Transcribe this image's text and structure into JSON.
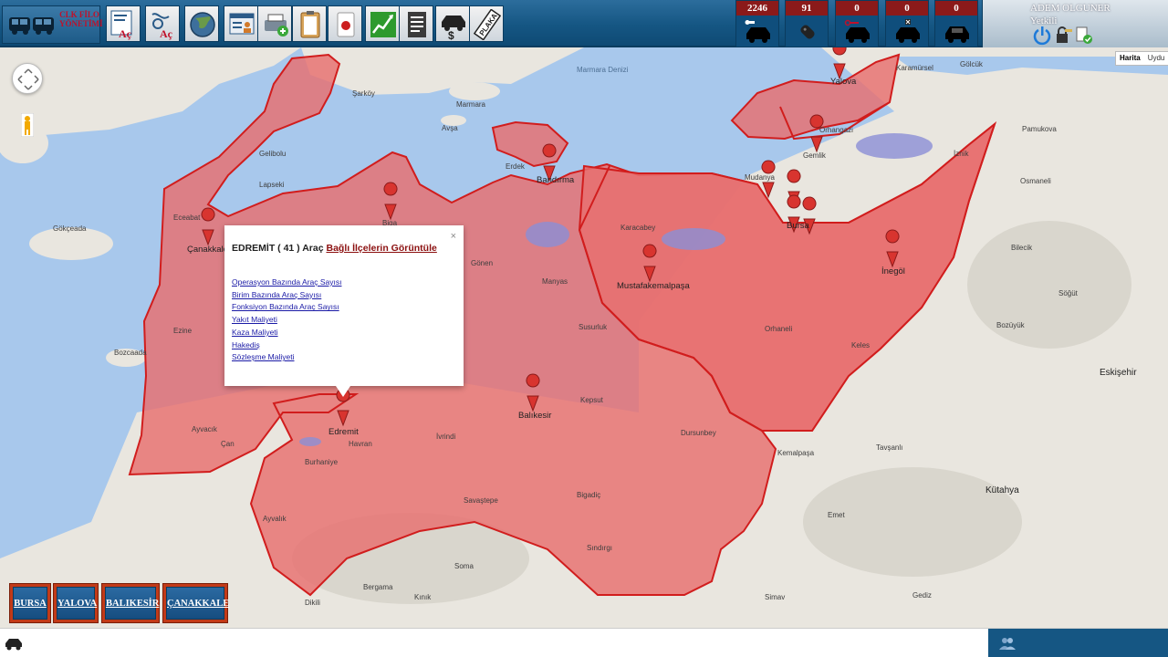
{
  "app": {
    "logo_text": "CLK FİLO YÖNETİMİ"
  },
  "toolbar": {
    "tools": [
      {
        "name": "open-report-tool",
        "label": "Aç"
      },
      {
        "name": "open-route-tool",
        "label": "Aç"
      },
      {
        "name": "globe-tool",
        "label": ""
      },
      {
        "name": "user-card-tool",
        "label": ""
      },
      {
        "name": "add-vehicle-tool",
        "label": ""
      },
      {
        "name": "clipboard-tool",
        "label": ""
      },
      {
        "name": "alert-tool",
        "label": ""
      },
      {
        "name": "chart-tool",
        "label": ""
      },
      {
        "name": "document-tool",
        "label": ""
      },
      {
        "name": "cost-tool",
        "label": ""
      },
      {
        "name": "plate-tool",
        "label": "PLAKA"
      }
    ]
  },
  "stats": [
    {
      "value": "2246",
      "icon": "car-key-icon"
    },
    {
      "value": "91",
      "icon": "key-icon"
    },
    {
      "value": "0",
      "icon": "car-key-icon"
    },
    {
      "value": "0",
      "icon": "car-wrench-icon"
    },
    {
      "value": "0",
      "icon": "car-icon"
    }
  ],
  "user": {
    "name": "ADEM OLGUNER",
    "role": "Yetkili"
  },
  "map": {
    "maptype": {
      "map": "Harita",
      "satellite": "Uydu"
    },
    "popup": {
      "title": "EDREMİT ( 41 ) Araç",
      "link": "Bağlı İlçelerin Görüntüle",
      "close": "×",
      "items": [
        "Operasyon Bazında Araç Sayısı",
        "Birim Bazında Araç Sayısı",
        "Fonksiyon Bazında Araç Sayısı",
        "Yakıt Maliyeti",
        "Kaza Maliyeti",
        "Hakediş",
        "Sözleşme Maliyeti"
      ]
    },
    "labels": {
      "marmara_sea": "Marmara Denizi",
      "bursa": "Bursa",
      "balikesir": "Balıkesir",
      "edremit": "Edremit",
      "bandirma": "Bandırma",
      "canakkale": "Çanakkale",
      "yalova": "Yalova",
      "gemlik": "Gemlik",
      "inegol": "İnegöl",
      "mustafakemalpasa": "Mustafakemalpaşa",
      "karacabey": "Karacabey",
      "eskisehir": "Eskişehir",
      "kutahya": "Kütahya",
      "bozuyuk": "Bozüyük",
      "gokceada": "Gökçeada",
      "bozcaada": "Bozcaada",
      "ayvalik": "Ayvalık",
      "bergama": "Bergama",
      "simav": "Simav",
      "sindirgi": "Sındırgı",
      "bigadic": "Bigadiç",
      "dursunbey": "Dursunbey",
      "susurluk": "Susurluk",
      "gonen": "Gönen",
      "biga": "Biga",
      "can": "Çan",
      "ezine": "Ezine",
      "ayvacik": "Ayvacık",
      "burhaniye": "Burhaniye",
      "havran": "Havran",
      "ivrindi": "İvrindi",
      "kepsut": "Kepsut",
      "manyas": "Manyas",
      "orhangazi": "Orhangazi",
      "iznik": "İznik",
      "orhaneli": "Orhaneli",
      "keles": "Keles",
      "mudanya": "Mudanya",
      "karamursel": "Karamürsel",
      "golcuk": "Gölcük",
      "pamukova": "Pamukova",
      "osmaneli": "Osmaneli",
      "bilecik": "Bilecik",
      "sogut": "Söğüt",
      "tavsanli": "Tavşanlı",
      "gediz": "Gediz",
      "emet": "Emet",
      "savastepe": "Savaştepe",
      "soma": "Soma",
      "kinik": "Kınık",
      "dikili": "Dikili",
      "sarkoy": "Şarköy",
      "erdek": "Erdek",
      "gelibolu": "Gelibolu",
      "lapseki": "Lapseki",
      "eceabat": "Eceabat",
      "marmara": "Marmara",
      "avsa": "Avşa",
      "kemalpasa": "Kemalpaşa"
    }
  },
  "provinces": [
    "BURSA",
    "YALOVA",
    "BALIKESİR",
    "ÇANAKKALE"
  ],
  "colors": {
    "topbar": "#155683",
    "region_fill": "#e86f6f",
    "region_stroke": "#d11d1d",
    "province_button_border": "#c23a18",
    "popup_link": "#8b0f0f"
  }
}
